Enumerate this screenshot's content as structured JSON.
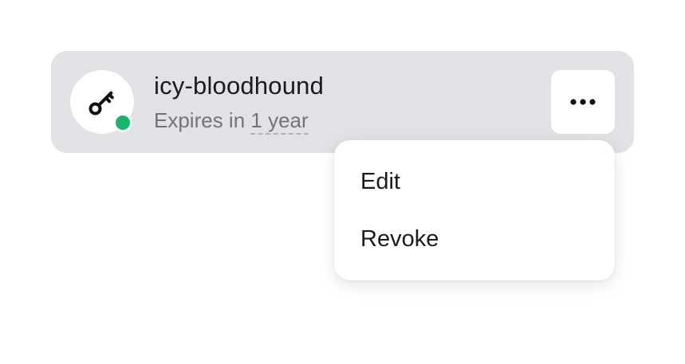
{
  "key": {
    "name": "icy-bloodhound",
    "expires_prefix": "Expires in ",
    "expires_value": "1 year",
    "status": "active",
    "icon": "key-icon"
  },
  "menu": {
    "trigger_icon": "more-horizontal-icon",
    "items": [
      {
        "label": "Edit"
      },
      {
        "label": "Revoke"
      }
    ]
  },
  "colors": {
    "card_background": "#e1e2e5",
    "status_active": "#12b76a",
    "text_primary": "#1b1b1d",
    "text_secondary": "#737378"
  }
}
